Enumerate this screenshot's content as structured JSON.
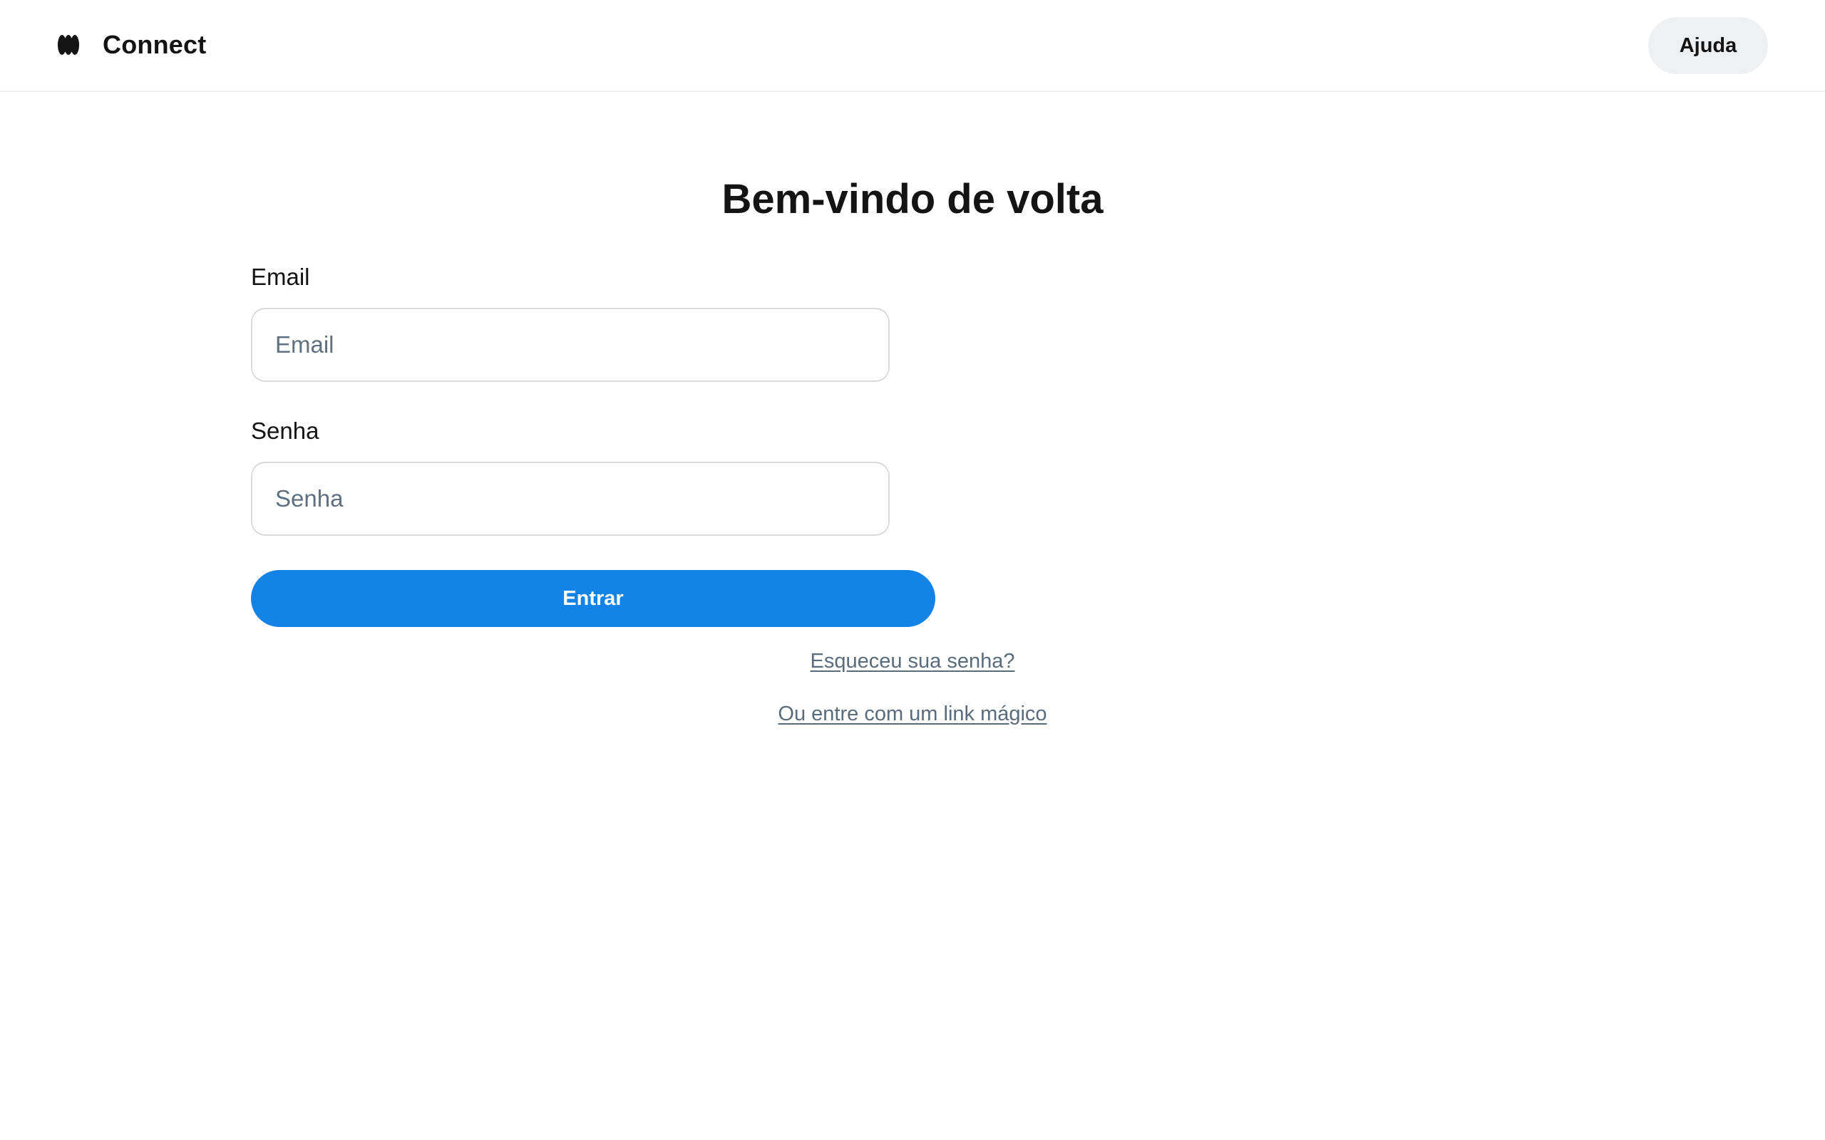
{
  "header": {
    "app_name": "Connect",
    "logo_icon": "connect-logo-icon",
    "help_label": "Ajuda"
  },
  "login": {
    "title": "Bem-vindo de volta",
    "email": {
      "label": "Email",
      "placeholder": "Email",
      "value": ""
    },
    "password": {
      "label": "Senha",
      "placeholder": "Senha",
      "value": ""
    },
    "submit_label": "Entrar",
    "forgot_password_link": "Esqueceu sua senha?",
    "magic_link": "Ou entre com um link mágico"
  },
  "colors": {
    "primary": "#1483e8",
    "text": "#141414",
    "muted_link": "#5a6b7b",
    "help_button_bg": "#eef0f2",
    "input_border": "#d9dcdf"
  }
}
